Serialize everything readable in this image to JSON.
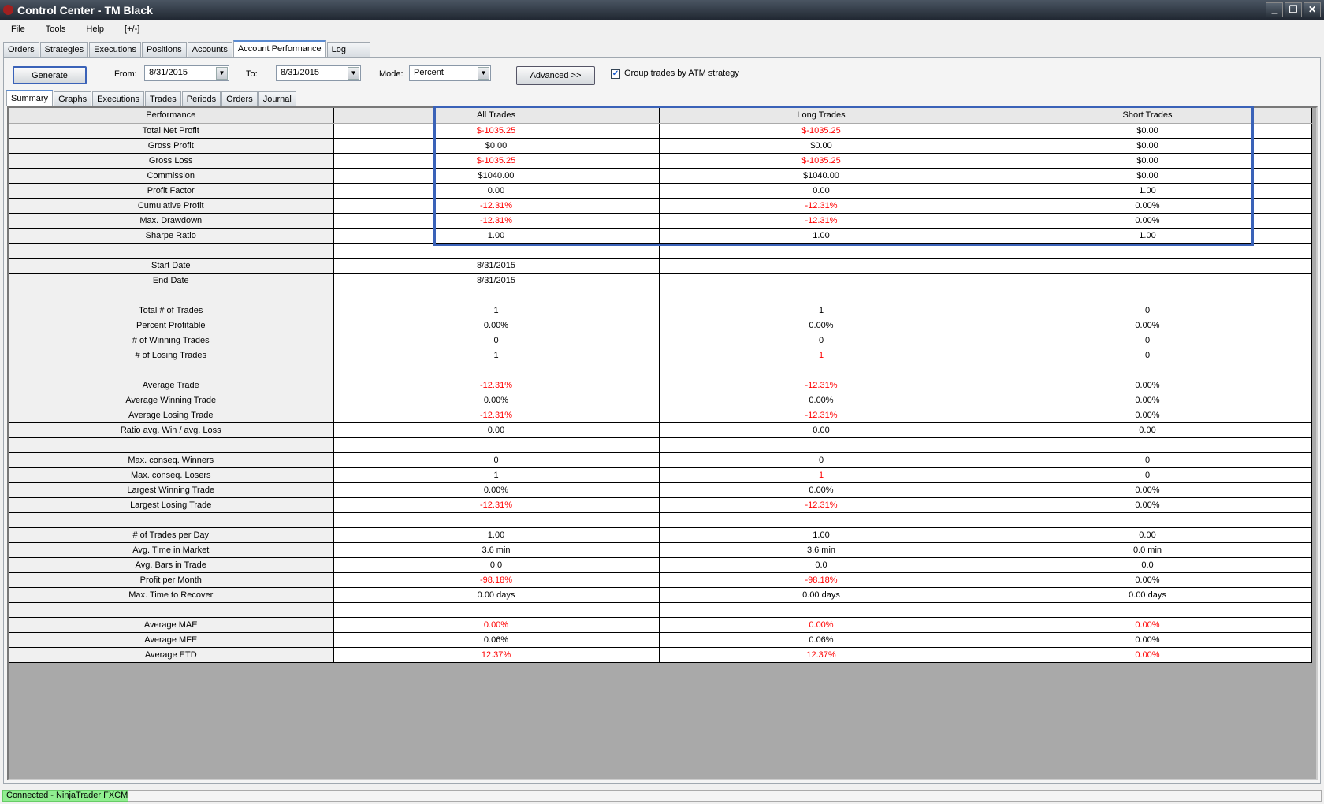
{
  "window": {
    "title": "Control Center - TM Black"
  },
  "menu": [
    "File",
    "Tools",
    "Help",
    "[+/-]"
  ],
  "tabs": [
    "Orders",
    "Strategies",
    "Executions",
    "Positions",
    "Accounts",
    "Account Performance",
    "Log"
  ],
  "toolbar": {
    "generate": "Generate",
    "from_label": "From:",
    "from_value": "8/31/2015",
    "to_label": "To:",
    "to_value": "8/31/2015",
    "mode_label": "Mode:",
    "mode_value": "Percent",
    "advanced": "Advanced >>",
    "group_label": "Group trades by ATM strategy",
    "group_checked": true
  },
  "subtabs": [
    "Summary",
    "Graphs",
    "Executions",
    "Trades",
    "Periods",
    "Orders",
    "Journal"
  ],
  "table": {
    "headers": [
      "Performance",
      "All Trades",
      "Long Trades",
      "Short Trades"
    ],
    "rows": [
      {
        "label": "Total Net Profit",
        "v": [
          "$-1035.25",
          "$-1035.25",
          "$0.00"
        ],
        "red": [
          1,
          1,
          0
        ]
      },
      {
        "label": "Gross Profit",
        "v": [
          "$0.00",
          "$0.00",
          "$0.00"
        ],
        "red": [
          0,
          0,
          0
        ]
      },
      {
        "label": "Gross Loss",
        "v": [
          "$-1035.25",
          "$-1035.25",
          "$0.00"
        ],
        "red": [
          1,
          1,
          0
        ]
      },
      {
        "label": "Commission",
        "v": [
          "$1040.00",
          "$1040.00",
          "$0.00"
        ],
        "red": [
          0,
          0,
          0
        ]
      },
      {
        "label": "Profit Factor",
        "v": [
          "0.00",
          "0.00",
          "1.00"
        ],
        "red": [
          0,
          0,
          0
        ]
      },
      {
        "label": "Cumulative Profit",
        "v": [
          "-12.31%",
          "-12.31%",
          "0.00%"
        ],
        "red": [
          1,
          1,
          0
        ]
      },
      {
        "label": "Max. Drawdown",
        "v": [
          "-12.31%",
          "-12.31%",
          "0.00%"
        ],
        "red": [
          1,
          1,
          0
        ]
      },
      {
        "label": "Sharpe Ratio",
        "v": [
          "1.00",
          "1.00",
          "1.00"
        ],
        "red": [
          0,
          0,
          0
        ]
      },
      {
        "label": "",
        "v": [
          "",
          "",
          ""
        ],
        "red": [
          0,
          0,
          0
        ]
      },
      {
        "label": "Start Date",
        "v": [
          "8/31/2015",
          "",
          ""
        ],
        "red": [
          0,
          0,
          0
        ]
      },
      {
        "label": "End Date",
        "v": [
          "8/31/2015",
          "",
          ""
        ],
        "red": [
          0,
          0,
          0
        ]
      },
      {
        "label": "",
        "v": [
          "",
          "",
          ""
        ],
        "red": [
          0,
          0,
          0
        ]
      },
      {
        "label": "Total # of Trades",
        "v": [
          "1",
          "1",
          "0"
        ],
        "red": [
          0,
          0,
          0
        ]
      },
      {
        "label": "Percent Profitable",
        "v": [
          "0.00%",
          "0.00%",
          "0.00%"
        ],
        "red": [
          0,
          0,
          0
        ]
      },
      {
        "label": "# of Winning Trades",
        "v": [
          "0",
          "0",
          "0"
        ],
        "red": [
          0,
          0,
          0
        ]
      },
      {
        "label": "# of Losing Trades",
        "v": [
          "1",
          "1",
          "0"
        ],
        "red": [
          0,
          1,
          0
        ]
      },
      {
        "label": "",
        "v": [
          "",
          "",
          ""
        ],
        "red": [
          0,
          0,
          0
        ]
      },
      {
        "label": "Average Trade",
        "v": [
          "-12.31%",
          "-12.31%",
          "0.00%"
        ],
        "red": [
          1,
          1,
          0
        ]
      },
      {
        "label": "Average Winning Trade",
        "v": [
          "0.00%",
          "0.00%",
          "0.00%"
        ],
        "red": [
          0,
          0,
          0
        ]
      },
      {
        "label": "Average Losing Trade",
        "v": [
          "-12.31%",
          "-12.31%",
          "0.00%"
        ],
        "red": [
          1,
          1,
          0
        ]
      },
      {
        "label": "Ratio avg. Win / avg. Loss",
        "v": [
          "0.00",
          "0.00",
          "0.00"
        ],
        "red": [
          0,
          0,
          0
        ]
      },
      {
        "label": "",
        "v": [
          "",
          "",
          ""
        ],
        "red": [
          0,
          0,
          0
        ]
      },
      {
        "label": "Max. conseq. Winners",
        "v": [
          "0",
          "0",
          "0"
        ],
        "red": [
          0,
          0,
          0
        ]
      },
      {
        "label": "Max. conseq. Losers",
        "v": [
          "1",
          "1",
          "0"
        ],
        "red": [
          0,
          1,
          0
        ]
      },
      {
        "label": "Largest Winning Trade",
        "v": [
          "0.00%",
          "0.00%",
          "0.00%"
        ],
        "red": [
          0,
          0,
          0
        ]
      },
      {
        "label": "Largest Losing Trade",
        "v": [
          "-12.31%",
          "-12.31%",
          "0.00%"
        ],
        "red": [
          1,
          1,
          0
        ]
      },
      {
        "label": "",
        "v": [
          "",
          "",
          ""
        ],
        "red": [
          0,
          0,
          0
        ]
      },
      {
        "label": "# of Trades per Day",
        "v": [
          "1.00",
          "1.00",
          "0.00"
        ],
        "red": [
          0,
          0,
          0
        ]
      },
      {
        "label": "Avg. Time in Market",
        "v": [
          "3.6 min",
          "3.6 min",
          "0.0 min"
        ],
        "red": [
          0,
          0,
          0
        ]
      },
      {
        "label": "Avg. Bars in Trade",
        "v": [
          "0.0",
          "0.0",
          "0.0"
        ],
        "red": [
          0,
          0,
          0
        ]
      },
      {
        "label": "Profit per Month",
        "v": [
          "-98.18%",
          "-98.18%",
          "0.00%"
        ],
        "red": [
          1,
          1,
          0
        ]
      },
      {
        "label": "Max. Time to Recover",
        "v": [
          "0.00 days",
          "0.00 days",
          "0.00 days"
        ],
        "red": [
          0,
          0,
          0
        ]
      },
      {
        "label": "",
        "v": [
          "",
          "",
          ""
        ],
        "red": [
          0,
          0,
          0
        ]
      },
      {
        "label": "Average MAE",
        "v": [
          "0.00%",
          "0.00%",
          "0.00%"
        ],
        "red": [
          1,
          1,
          1
        ]
      },
      {
        "label": "Average MFE",
        "v": [
          "0.06%",
          "0.06%",
          "0.00%"
        ],
        "red": [
          0,
          0,
          0
        ]
      },
      {
        "label": "Average ETD",
        "v": [
          "12.37%",
          "12.37%",
          "0.00%"
        ],
        "red": [
          1,
          1,
          1
        ]
      }
    ]
  },
  "status": {
    "connection": "Connected - NinjaTrader FXCM"
  },
  "colors": {
    "negative": "#ff0000",
    "highlight": "#3a62b8",
    "connected": "#90ee90"
  }
}
